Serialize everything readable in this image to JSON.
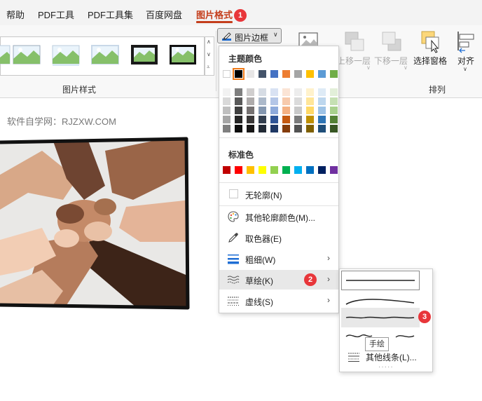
{
  "menubar": {
    "tabs": [
      "帮助",
      "PDF工具",
      "PDF工具集",
      "百度网盘",
      "图片格式"
    ],
    "active_tab": "图片格式"
  },
  "badges": [
    "1",
    "2",
    "3"
  ],
  "ribbon": {
    "picture_styles_label": "图片样式",
    "arrange_label": "排列",
    "border_button_label": "图片边框",
    "bring_forward": "上移一层",
    "send_backward": "下移一层",
    "selection_pane": "选择窗格",
    "align": "对齐"
  },
  "watermark": "软件自学网：RJZXW.COM",
  "dropdown": {
    "theme_colors_heading": "主题颜色",
    "standard_colors_heading": "标准色",
    "theme_colors": [
      "#ffffff",
      "#000000",
      "#e7e6e6",
      "#44546a",
      "#4472c4",
      "#ed7d31",
      "#a5a5a5",
      "#ffc000",
      "#5b9bd5",
      "#70ad47"
    ],
    "theme_shades": [
      [
        "#f2f2f2",
        "#d9d9d9",
        "#bfbfbf",
        "#a6a6a6",
        "#808080"
      ],
      [
        "#7f7f7f",
        "#595959",
        "#404040",
        "#262626",
        "#0d0d0d"
      ],
      [
        "#d0cece",
        "#aeabab",
        "#757171",
        "#3a3838",
        "#171616"
      ],
      [
        "#d6dce4",
        "#acb9ca",
        "#8497b0",
        "#333f4f",
        "#222a35"
      ],
      [
        "#d9e2f3",
        "#b4c6e7",
        "#8eaadb",
        "#2f5496",
        "#1f3864"
      ],
      [
        "#fbe4d5",
        "#f7caac",
        "#f4b183",
        "#c55a11",
        "#843c0b"
      ],
      [
        "#ededed",
        "#dbdbdb",
        "#c9c9c9",
        "#7b7b7b",
        "#525252"
      ],
      [
        "#fff2cc",
        "#ffe699",
        "#ffd966",
        "#bf9000",
        "#7f6000"
      ],
      [
        "#deebf6",
        "#bdd7ee",
        "#9dc3e6",
        "#2e75b5",
        "#1f4e79"
      ],
      [
        "#e2efd9",
        "#c5e0b3",
        "#a8d08d",
        "#538135",
        "#375623"
      ]
    ],
    "standard_colors": [
      "#c00000",
      "#ff0000",
      "#ffc000",
      "#ffff00",
      "#92d050",
      "#00b050",
      "#00b0f0",
      "#0070c0",
      "#002060",
      "#7030a0"
    ],
    "items": {
      "no_outline": "无轮廓(N)",
      "more_colors": "其他轮廓颜色(M)...",
      "eyedropper": "取色器(E)",
      "weight": "粗细(W)",
      "sketched": "草绘(K)",
      "dashes": "虚线(S)"
    }
  },
  "submenu": {
    "tooltip": "手绘",
    "more_lines": "其他线条(L)..."
  },
  "colors": {
    "accent": "#c43e1c",
    "badge": "#e8363a",
    "selected_outline": "#ef7b1a"
  }
}
